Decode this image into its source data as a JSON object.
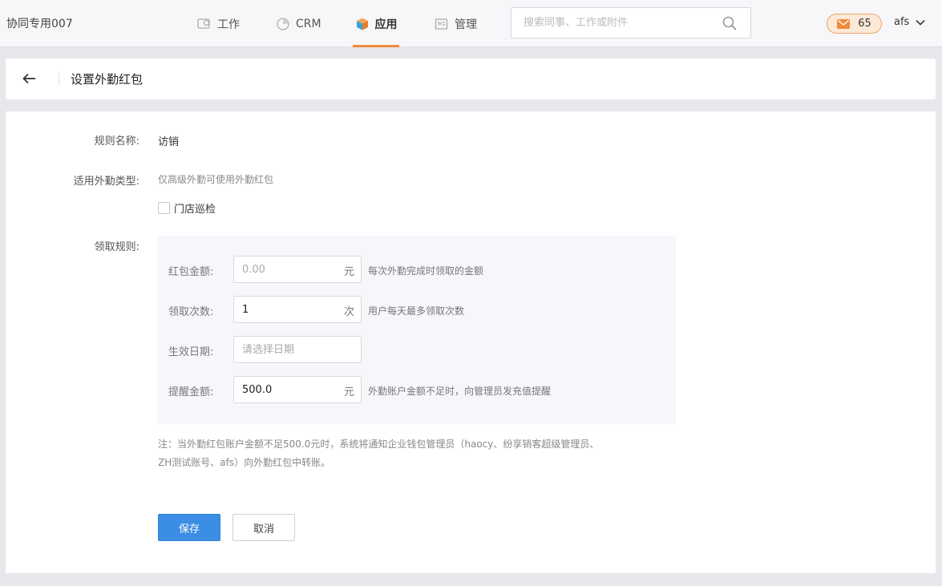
{
  "topbar": {
    "company": "协同专用007",
    "nav": [
      {
        "label": "工作",
        "icon": "work-icon"
      },
      {
        "label": "CRM",
        "icon": "crm-chart-icon"
      },
      {
        "label": "应用",
        "icon": "app-cube-icon",
        "active": true
      },
      {
        "label": "管理",
        "icon": "manage-icon"
      }
    ],
    "search_placeholder": "搜索同事、工作或附件",
    "mail_count": "65",
    "username": "afs",
    "accent_color": "#f08a3c"
  },
  "header": {
    "title": "设置外勤红包"
  },
  "form": {
    "rule_name_label": "规则名称:",
    "rule_name_value": "访销",
    "type_label": "适用外勤类型:",
    "type_hint": "仅高级外勤可使用外勤红包",
    "checkbox_label": "门店巡检",
    "rules_label": "领取规则:",
    "rules": {
      "amount": {
        "label": "红包金额:",
        "placeholder": "0.00",
        "value": "",
        "unit": "元",
        "hint": "每次外勤完成时领取的金额"
      },
      "times": {
        "label": "领取次数:",
        "placeholder": "",
        "value": "1",
        "unit": "次",
        "hint": "用户每天最多领取次数"
      },
      "date": {
        "label": "生效日期:",
        "placeholder": "请选择日期",
        "value": ""
      },
      "remind": {
        "label": "提醒金额:",
        "placeholder": "",
        "value": "500.0",
        "unit": "元",
        "hint": "外勤账户金额不足时，向管理员发充值提醒"
      }
    },
    "note_line1": "注：当外勤红包账户金额不足500.0元时，系统将通知企业钱包管理员（haocy、纷享销客超级管理员、",
    "note_line2": "ZH测试账号、afs）向外勤红包中转账。",
    "save_label": "保存",
    "cancel_label": "取消",
    "primary_color": "#3b8ee3"
  }
}
